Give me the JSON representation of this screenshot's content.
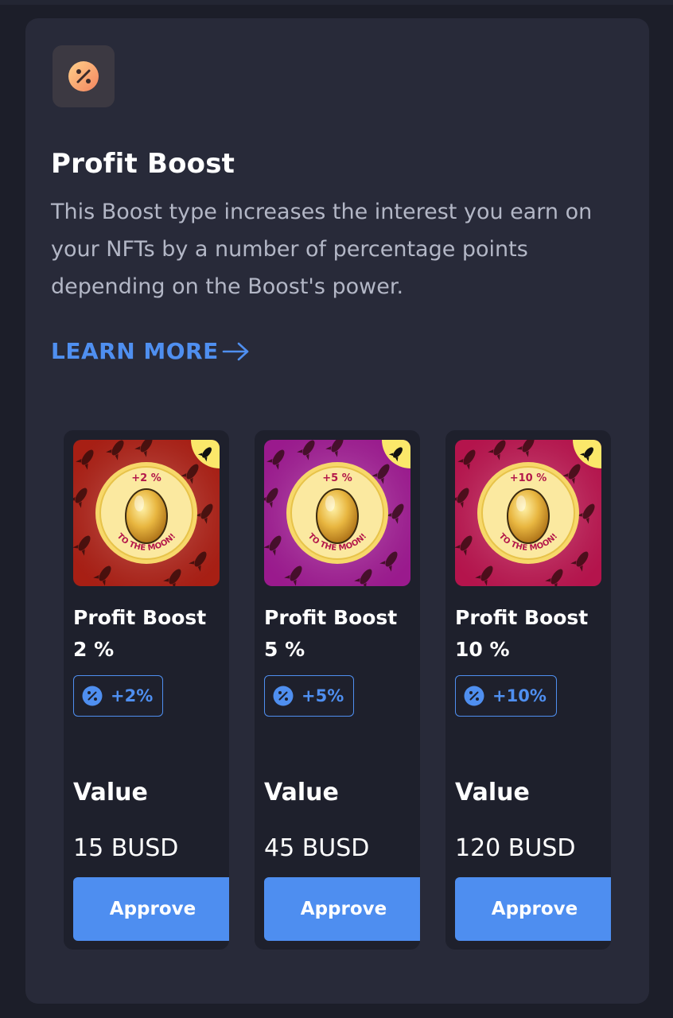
{
  "header": {
    "icon": "percent-badge-icon",
    "title": "Profit Boost",
    "description": "This Boost type increases the interest you earn on your NFTs by a number of percentage points depending on the Boost's power.",
    "learn_more": "LEARN MORE",
    "learn_more_icon": "arrow-right-icon"
  },
  "cards": [
    {
      "image_text_top": "+2 %",
      "image_text_bottom": "TO THE MOON!",
      "image_bg": "#c42418",
      "title": "Profit Boost 2 %",
      "chip_icon": "percent-icon",
      "chip": "+2%",
      "value_label": "Value",
      "value": "15 BUSD",
      "button": "Approve"
    },
    {
      "image_text_top": "+5 %",
      "image_text_bottom": "TO THE MOON!",
      "image_bg": "#b51fa6",
      "title": "Profit Boost 5 %",
      "chip_icon": "percent-icon",
      "chip": "+5%",
      "value_label": "Value",
      "value": "45 BUSD",
      "button": "Approve"
    },
    {
      "image_text_top": "+10 %",
      "image_text_bottom": "TO THE MOON!",
      "image_bg": "#d4185a",
      "title": "Profit Boost 10 %",
      "chip_icon": "percent-icon",
      "chip": "+10%",
      "value_label": "Value",
      "value": "120 BUSD",
      "button": "Approve"
    }
  ],
  "colors": {
    "accent": "#4f8ff0",
    "panel": "#282a39",
    "card": "#1e202c"
  }
}
